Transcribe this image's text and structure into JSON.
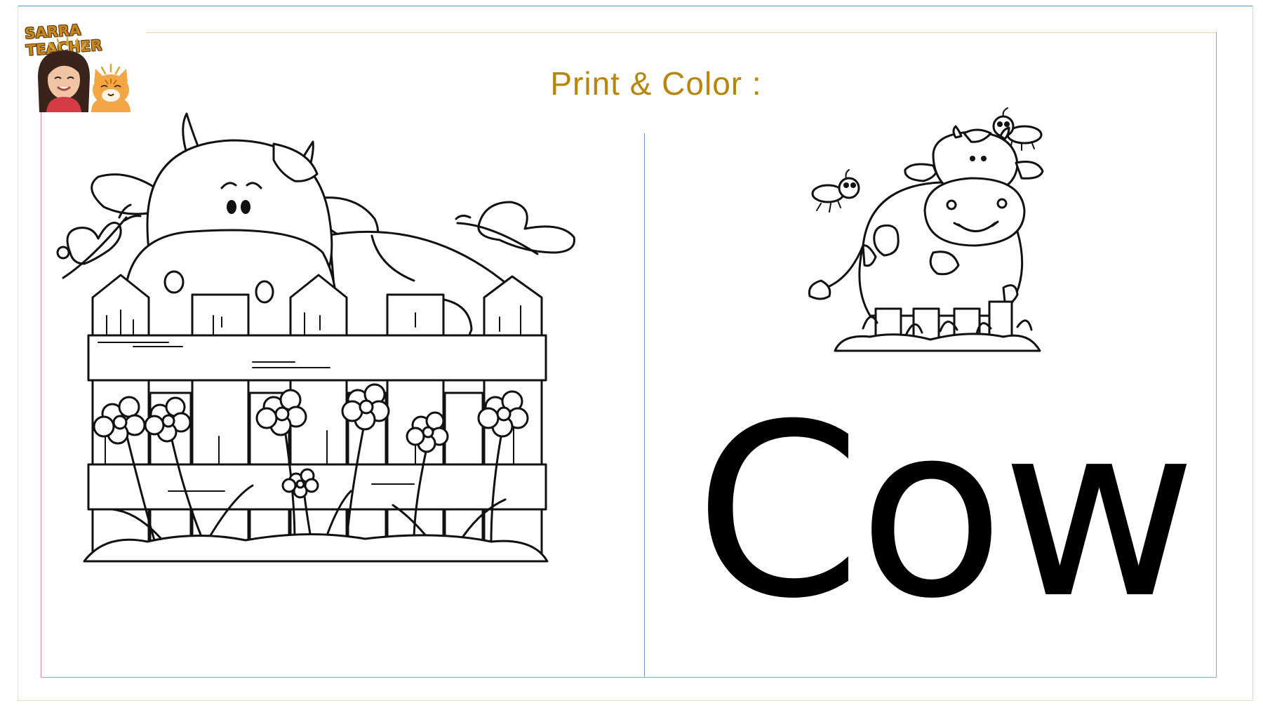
{
  "header": {
    "title": "Print & Color :"
  },
  "logo": {
    "text": "SARRA TEACHER"
  },
  "main": {
    "word": "Cow"
  },
  "icons": [
    "sarra-teacher-logo-icon",
    "teacher-avatar-icon",
    "cat-avatar-icon",
    "cow-fence-coloring-icon",
    "cow-standing-coloring-icon"
  ]
}
